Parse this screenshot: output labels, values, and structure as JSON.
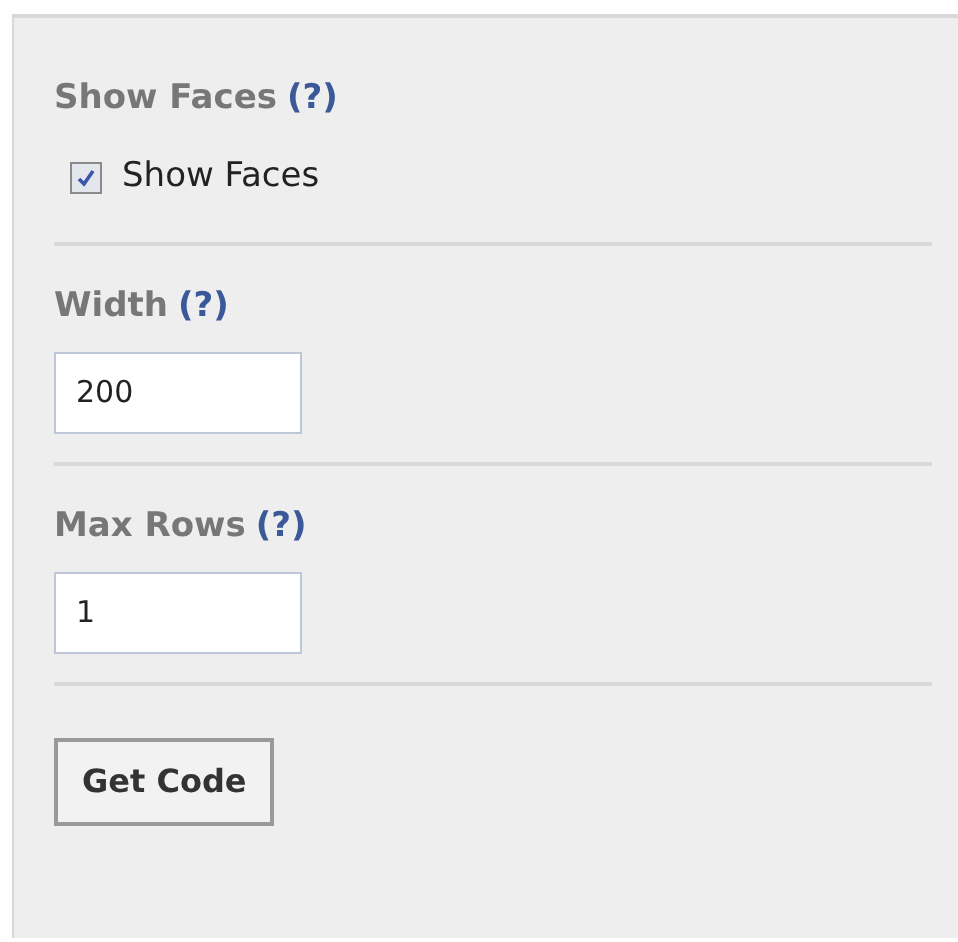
{
  "sections": [
    {
      "kind": "checkbox",
      "label": "Show Faces",
      "help": "(?)",
      "option": "Show Faces",
      "checked": true
    },
    {
      "kind": "text",
      "label": "Width",
      "help": "(?)",
      "value": "200"
    },
    {
      "kind": "text",
      "label": "Max Rows",
      "help": "(?)",
      "value": "1"
    }
  ],
  "button": "Get Code"
}
